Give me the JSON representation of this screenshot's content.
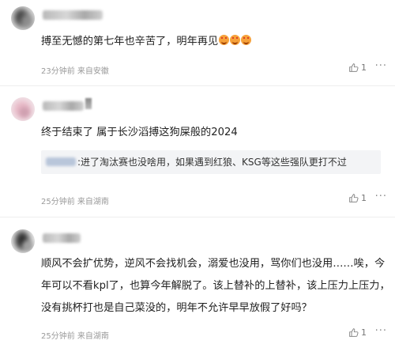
{
  "comments": [
    {
      "username": "",
      "text": "搏至无憾的第七年也辛苦了，明年再见",
      "emoji": "laughing-crying-icon",
      "time": "23分钟前",
      "location": "来自安徽",
      "likes": "1",
      "more": "···"
    },
    {
      "username": "",
      "text": "终于结束了 属于长沙滔搏这狗屎般的2024",
      "reply_text": ":进了淘汰赛也没啥用，如果遇到红狼、KSG等这些强队更打不过",
      "time": "25分钟前",
      "location": "来自湖南",
      "likes": "1",
      "more": "···"
    },
    {
      "username": "",
      "text_lines": [
        "顺风不会扩优势，逆风不会找机会，溺爱也没用，骂你们也没用……唉，今",
        "年可以不看kpl了，也算今年解脱了。该上替补的上替补，该上压力上压力，",
        "没有挑杯打也是自己菜没的，明年不允许早早放假了好吗？"
      ],
      "time": "25分钟前",
      "location": "来自湖南",
      "likes": "1",
      "more": "···"
    }
  ],
  "colors": {
    "text": "#222222",
    "meta": "#9a9a9a",
    "quote_bg": "#f3f4f6",
    "divider": "#eeeeee"
  }
}
